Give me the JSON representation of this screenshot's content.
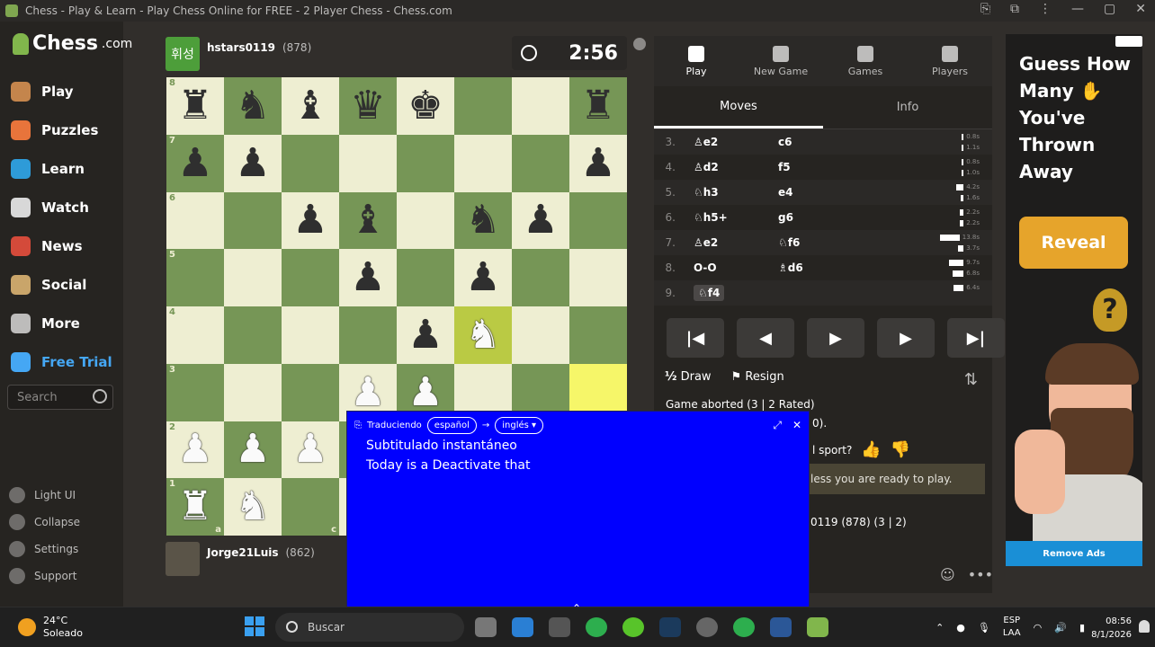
{
  "browser": {
    "title": "Chess - Play & Learn - Play Chess Online for FREE - 2 Player Chess - Chess.com"
  },
  "sidebar": {
    "logo": "Chess",
    "logo_suffix": ".com",
    "items": [
      {
        "label": "Play",
        "icon": "play-pawn-icon",
        "color": "#c4854c"
      },
      {
        "label": "Puzzles",
        "icon": "puzzle-icon",
        "color": "#e8743b"
      },
      {
        "label": "Learn",
        "icon": "learn-cube-icon",
        "color": "#2e9bd8"
      },
      {
        "label": "Watch",
        "icon": "binoculars-icon",
        "color": "#d8d8d8"
      },
      {
        "label": "News",
        "icon": "newspaper-icon",
        "color": "#d44a3a"
      },
      {
        "label": "Social",
        "icon": "people-icon",
        "color": "#c9a56a"
      },
      {
        "label": "More",
        "icon": "dots-icon",
        "color": "#bdbcbb"
      },
      {
        "label": "Free Trial",
        "icon": "diamond-icon",
        "color": "#45a7f4"
      }
    ],
    "search_placeholder": "Search",
    "bottom": [
      "Light UI",
      "Collapse",
      "Settings",
      "Support"
    ]
  },
  "game": {
    "top_player": {
      "avatar_text": "휘성",
      "name": "hstars0119",
      "rating": "(878)"
    },
    "bottom_player": {
      "name": "Jorge21Luis",
      "rating": "(862)"
    },
    "clock": "2:56",
    "ranks": [
      "8",
      "7",
      "6",
      "5",
      "4",
      "3",
      "2",
      "1"
    ],
    "files_visible": [
      "a",
      "c"
    ]
  },
  "panel": {
    "tabs": [
      {
        "label": "Play",
        "icon": "lightning-icon",
        "active": true
      },
      {
        "label": "New Game",
        "icon": "plus-icon",
        "active": false
      },
      {
        "label": "Games",
        "icon": "games-grid-icon",
        "active": false
      },
      {
        "label": "Players",
        "icon": "players-icon",
        "active": false
      }
    ],
    "subtabs": [
      {
        "label": "Moves",
        "active": true
      },
      {
        "label": "Info",
        "active": false
      }
    ],
    "moves": [
      {
        "n": "3.",
        "w": "♙e2",
        "b": "c6",
        "tw": "0.8s",
        "tb": "1.1s",
        "fw": 2,
        "fb": 2
      },
      {
        "n": "4.",
        "w": "♙d2",
        "b": "f5",
        "tw": "0.8s",
        "tb": "1.0s",
        "fw": 2,
        "fb": 2
      },
      {
        "n": "5.",
        "w": "♘h3",
        "b": "e4",
        "tw": "4.2s",
        "tb": "1.6s",
        "fw": 8,
        "fb": 3
      },
      {
        "n": "6.",
        "w": "♘h5+",
        "b": "g6",
        "tw": "2.2s",
        "tb": "2.2s",
        "fw": 4,
        "fb": 4
      },
      {
        "n": "7.",
        "w": "♙e2",
        "b": "♘f6",
        "tw": "13.8s",
        "tb": "3.7s",
        "fw": 22,
        "fb": 6
      },
      {
        "n": "8.",
        "w": "O-O",
        "b": "♗d6",
        "tw": "9.7s",
        "tb": "6.8s",
        "fw": 16,
        "fb": 12
      },
      {
        "n": "9.",
        "w": "♘f4",
        "b": "",
        "tw": "6.4s",
        "tb": "",
        "fw": 11,
        "fb": 0
      }
    ],
    "controls": [
      "|◀",
      "◀",
      "▶",
      "▶",
      "▶|"
    ],
    "draw_label": "Draw",
    "draw_icon_text": "½",
    "resign_label": "Resign",
    "aborted_text": "Game aborted (3 | 2 Rated)",
    "partial_a": "0).",
    "sport_text": "l sport?",
    "ready_text": "less you are ready to play.",
    "stats_text": "0119 (878) (3 | 2)"
  },
  "ad": {
    "headline": "Guess How Many ✋ You've Thrown Away",
    "cta": "Reveal",
    "remove": "Remove Ads"
  },
  "translator": {
    "status": "Traduciendo",
    "from": "español",
    "arrow": "→",
    "to": "inglés",
    "line1": "Subtitulado instantáneo",
    "line2": "Today is a Deactivate that"
  },
  "taskbar": {
    "temp": "24°C",
    "condition": "Soleado",
    "search": "Buscar",
    "lang1": "ESP",
    "lang2": "LAA",
    "time": "08:56",
    "date": "8/1/2026"
  }
}
